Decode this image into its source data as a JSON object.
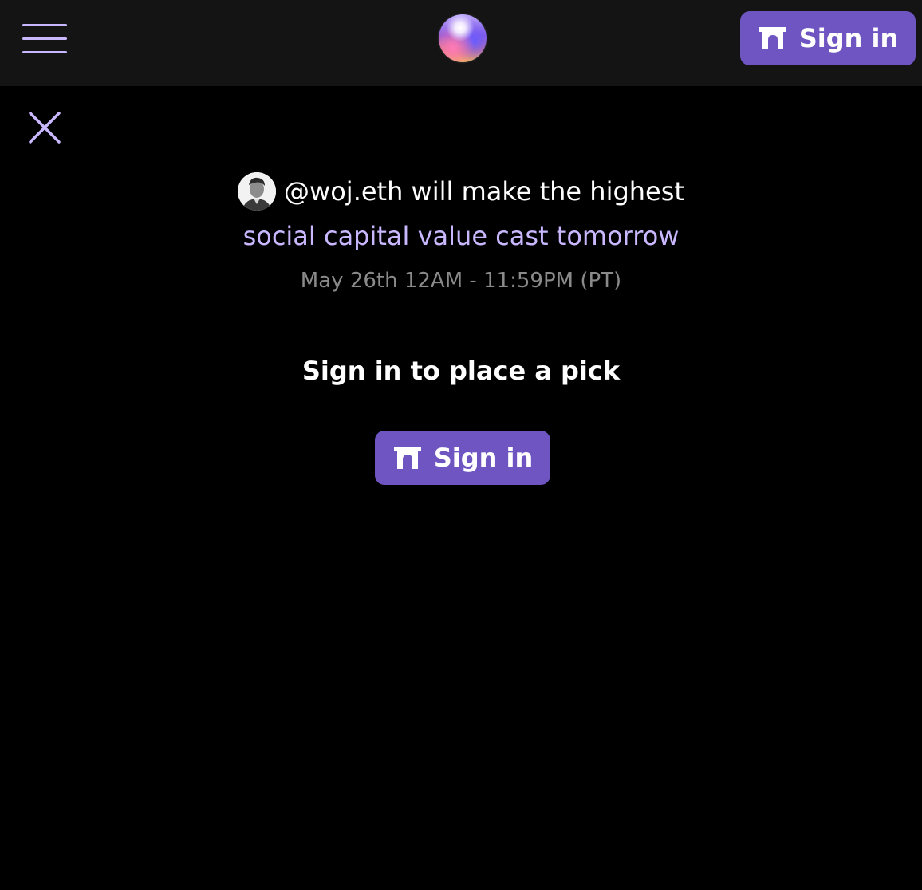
{
  "header": {
    "menu_icon": "hamburger-menu-icon",
    "logo_icon": "orb-logo-icon",
    "sign_in_label": "Sign in",
    "sign_in_icon": "gateway-arch-icon"
  },
  "modal": {
    "close_icon": "close-x-icon",
    "avatar_icon": "user-avatar",
    "headline_line1": "@woj.eth will make the highest",
    "headline_line2": "social capital value cast tomorrow",
    "timeframe": "May 26th 12AM - 11:59PM (PT)",
    "prompt": "Sign in to place a pick",
    "sign_in_label": "Sign in",
    "sign_in_icon": "gateway-arch-icon"
  },
  "colors": {
    "background": "#000000",
    "topbar": "#141414",
    "accent": "#6e55c2",
    "highlight_text": "#c9b8ff",
    "muted_text": "#8a8a8a"
  }
}
